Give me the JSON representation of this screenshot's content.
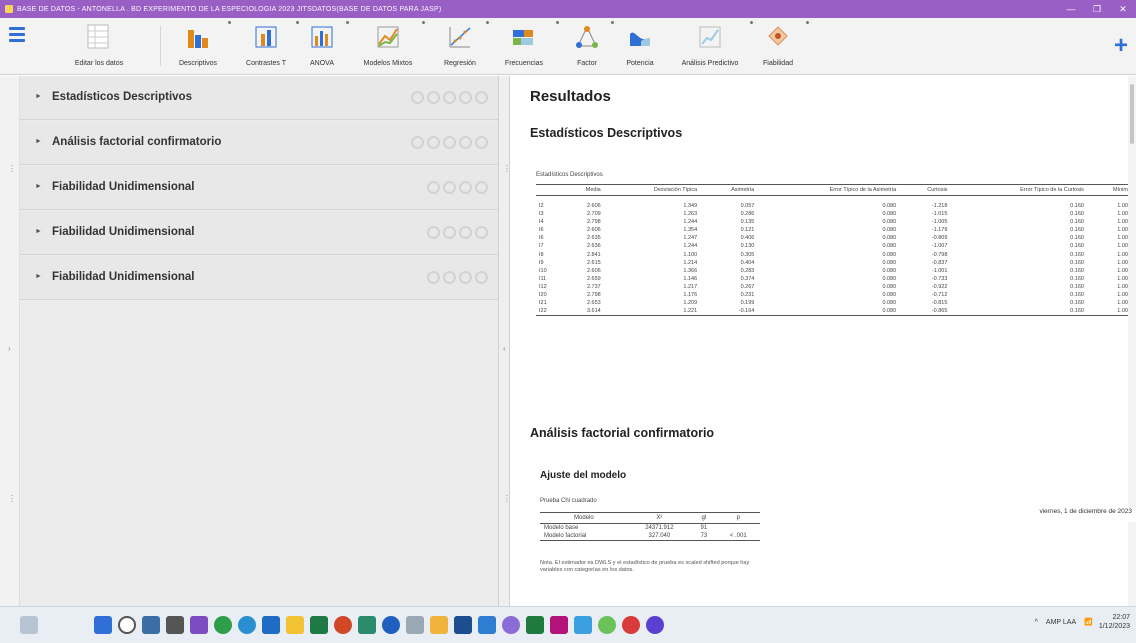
{
  "window": {
    "title": "BASE DE DATOS - ANTONELLA  .  BD EXPERIMENTO DE LA ESPECIOLOGIA 2023 JITSDATOS(BASE DE DATOS PARA JASP)",
    "controls": [
      "—",
      "❐",
      "✕"
    ]
  },
  "ribbon": {
    "tools": [
      {
        "label": "Editar los datos"
      },
      {
        "label": "Descriptivos"
      },
      {
        "label": "Contrastes T"
      },
      {
        "label": "ANOVA"
      },
      {
        "label": "Modelos Mixtos"
      },
      {
        "label": "Regresión"
      },
      {
        "label": "Frecuencias"
      },
      {
        "label": "Factor"
      },
      {
        "label": "Potencia"
      },
      {
        "label": "Análisis Predictivo"
      },
      {
        "label": "Fiabilidad"
      }
    ],
    "add_symbol": "+"
  },
  "analyses": [
    {
      "title": "Estadísticos Descriptivos"
    },
    {
      "title": "Análisis factorial confirmatorio"
    },
    {
      "title": "Fiabilidad Unidimensional"
    },
    {
      "title": "Fiabilidad Unidimensional"
    },
    {
      "title": "Fiabilidad Unidimensional"
    }
  ],
  "results": {
    "heading": "Resultados",
    "descriptives": {
      "heading": "Estadísticos Descriptivos",
      "caption": "Estadísticos Descriptivos",
      "columns": [
        "",
        "Media",
        "Desviación Típica",
        "Asimetría",
        "Error Típico de la Asimetría",
        "Curtosis",
        "Error Típico de la Curtosis",
        "Mínimo"
      ],
      "rows": [
        [
          "I2",
          "2.606",
          "1.349",
          "0.057",
          "0.080",
          "-1.218",
          "0.160",
          "1.000"
        ],
        [
          "I3",
          "2.709",
          "1.263",
          "0.286",
          "0.080",
          "-1.015",
          "0.160",
          "1.000"
        ],
        [
          "I4",
          "2.798",
          "1.244",
          "0.135",
          "0.080",
          "-1.005",
          "0.160",
          "1.000"
        ],
        [
          "I6",
          "2.606",
          "1.354",
          "0.121",
          "0.080",
          "-1.179",
          "0.160",
          "1.000"
        ],
        [
          "I6",
          "2.635",
          "1.247",
          "0.406",
          "0.080",
          "-0.809",
          "0.160",
          "1.000"
        ],
        [
          "I7",
          "2.636",
          "1.244",
          "0.130",
          "0.080",
          "-1.007",
          "0.160",
          "1.000"
        ],
        [
          "I8",
          "2.841",
          "1.100",
          "0.305",
          "0.080",
          "-0.798",
          "0.160",
          "1.000"
        ],
        [
          "I9",
          "2.615",
          "1.214",
          "0.404",
          "0.080",
          "-0.837",
          "0.160",
          "1.000"
        ],
        [
          "I10",
          "2.606",
          "1.366",
          "0.283",
          "0.080",
          "-1.001",
          "0.160",
          "1.000"
        ],
        [
          "I11",
          "2.659",
          "1.146",
          "0.374",
          "0.080",
          "-0.733",
          "0.160",
          "1.000"
        ],
        [
          "I12",
          "2.737",
          "1.217",
          "0.267",
          "0.080",
          "-0.922",
          "0.160",
          "1.000"
        ],
        [
          "I20",
          "2.798",
          "1.176",
          "0.231",
          "0.080",
          "-0.712",
          "0.160",
          "1.000"
        ],
        [
          "I21",
          "2.653",
          "1.209",
          "0.199",
          "0.080",
          "-0.815",
          "0.160",
          "1.000"
        ],
        [
          "I22",
          "3.614",
          "1.221",
          "-0.164",
          "0.080",
          "-0.865",
          "0.160",
          "1.000"
        ]
      ]
    },
    "cfa": {
      "heading": "Análisis factorial confirmatorio",
      "fit_heading": "Ajuste del modelo",
      "fit_caption": "Prueba Chi cuadrado",
      "columns": [
        "Modelo",
        "X²",
        "gl",
        "p"
      ],
      "rows": [
        [
          "Modelo base",
          "24371.912",
          "91",
          ""
        ],
        [
          "Modelo factorial",
          "327.040",
          "73",
          "< .001"
        ]
      ],
      "note": "Nota. El estimador es DWLS y el estadístico de prueba es scaled shifted porque hay variables con categorías en los datos."
    },
    "date_tooltip": "viernes, 1 de diciembre de 2023"
  },
  "taskbar": {
    "tray_text": "^",
    "weather": "AMP LAA",
    "time": "22:07",
    "date": "1/12/2023"
  }
}
